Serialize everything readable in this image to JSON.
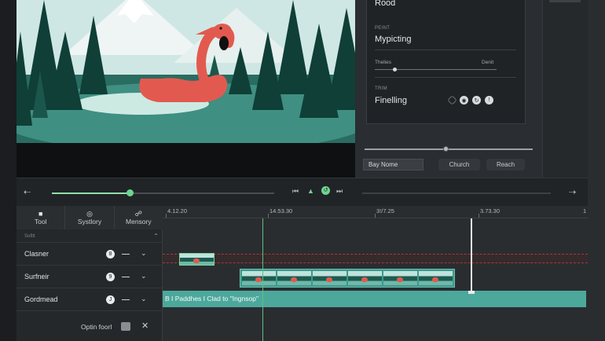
{
  "inspector": {
    "card_title": "Rood",
    "section_paint_label": "PEINT",
    "section_paint_value": "Mypicting",
    "range_left_label": "Thelies",
    "range_right_label": "Denit",
    "range_level": 0.15,
    "section_trim_label": "TRIM",
    "section_trim_value": "Finelling",
    "search_input_value": "Bay Nome",
    "church_button": "Church",
    "reach_button": "Reach"
  },
  "transport": {
    "scrub_progress": 0.35
  },
  "tracks": {
    "tabs": [
      {
        "label": "Tool",
        "icon": "toolbox-icon"
      },
      {
        "label": "Systlory",
        "icon": "circle-icon"
      },
      {
        "label": "Mensory",
        "icon": "waveform-icon"
      }
    ],
    "group_label": "Sofitt",
    "rows": [
      {
        "name": "Clasner",
        "badge": "8"
      },
      {
        "name": "Surfneir",
        "badge": "9"
      },
      {
        "name": "Gordmead",
        "badge": "J"
      }
    ],
    "option_label": "Optin foorl"
  },
  "timeline": {
    "ruler": [
      "4.12.20",
      "14.53.30",
      "3!/7.25",
      "3.73.30",
      "1"
    ],
    "caption_text": "B I Paddhes I Clad to \"Ingnsop\""
  },
  "colors": {
    "accent_green": "#6ed48e",
    "clip_teal": "#4da89c",
    "flamingo": "#e05a4e"
  }
}
